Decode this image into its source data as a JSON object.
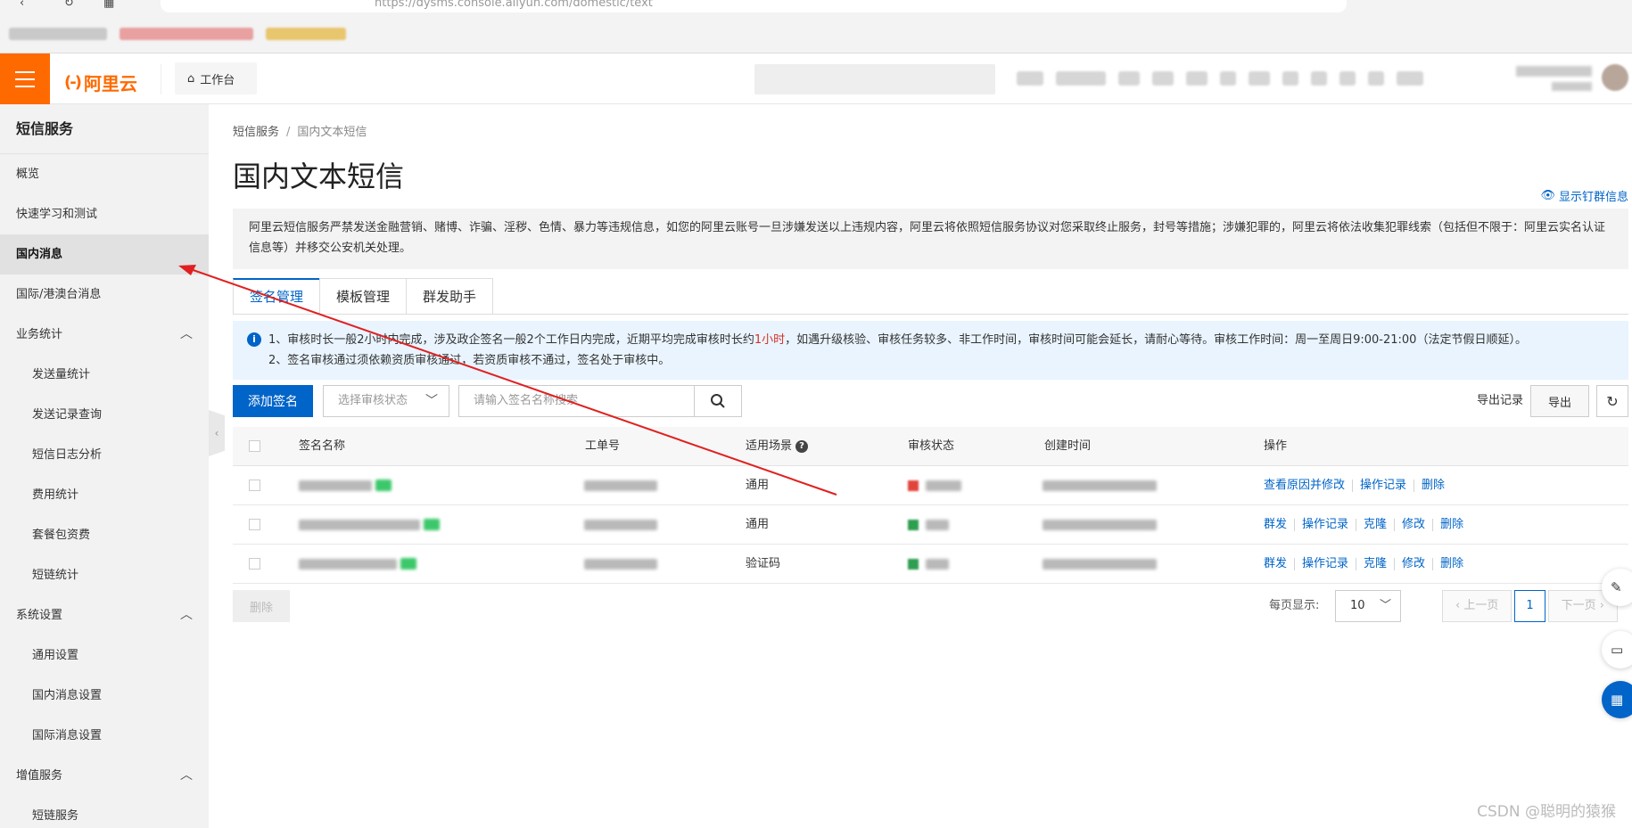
{
  "browser": {
    "url": "https://dysms.console.aliyun.com/domestic/text"
  },
  "header": {
    "logo_text": "阿里云",
    "logo_mark": "(-)",
    "workbench_label": "工作台"
  },
  "sidebar": {
    "title": "短信服务",
    "items": [
      {
        "label": "概览"
      },
      {
        "label": "快速学习和测试"
      },
      {
        "label": "国内消息"
      },
      {
        "label": "国际/港澳台消息"
      },
      {
        "label": "业务统计"
      },
      {
        "label": "发送量统计"
      },
      {
        "label": "发送记录查询"
      },
      {
        "label": "短信日志分析"
      },
      {
        "label": "费用统计"
      },
      {
        "label": "套餐包资费"
      },
      {
        "label": "短链统计"
      },
      {
        "label": "系统设置"
      },
      {
        "label": "通用设置"
      },
      {
        "label": "国内消息设置"
      },
      {
        "label": "国际消息设置"
      },
      {
        "label": "增值服务"
      },
      {
        "label": "短链服务"
      }
    ]
  },
  "breadcrumb": {
    "root": "短信服务",
    "separator": "/",
    "current": "国内文本短信"
  },
  "page": {
    "title": "国内文本短信",
    "show_info_link": "显示钉群信息"
  },
  "notice": {
    "text": "阿里云短信服务严禁发送金融营销、赌博、诈骗、淫秽、色情、暴力等违规信息，如您的阿里云账号一旦涉嫌发送以上违规内容，阿里云将依照短信服务协议对您采取终止服务，封号等措施；涉嫌犯罪的，阿里云将依法收集犯罪线索（包括但不限于：阿里云实名认证信息等）并移交公安机关处理。"
  },
  "tabs": [
    {
      "label": "签名管理",
      "active": true
    },
    {
      "label": "模板管理",
      "active": false
    },
    {
      "label": "群发助手",
      "active": false
    }
  ],
  "info_box": {
    "line1_pre": "1、审核时长一般2小时内完成，涉及政企签名一般2个工作日内完成，近期平均完成审核时长约",
    "line1_highlight": "1小时",
    "line1_post": "，如遇升级核验、审核任务较多、非工作时间，审核时间可能会延长，请耐心等待。审核工作时间：周一至周日9:00-21:00（法定节假日顺延）。",
    "line2": "2、签名审核通过须依赖资质审核通过，若资质审核不通过，签名处于审核中。",
    "highlight_color": "#d93026"
  },
  "toolbar": {
    "add_label": "添加签名",
    "status_placeholder": "选择审核状态",
    "search_placeholder": "请输入签名名称搜索",
    "export_records_label": "导出记录",
    "export_label": "导出"
  },
  "table": {
    "headers": {
      "name": "签名名称",
      "ticket": "工单号",
      "scene": "适用场景",
      "status": "审核状态",
      "created": "创建时间",
      "actions": "操作"
    },
    "rows": [
      {
        "scene": "通用",
        "status_color": "#e0443a",
        "actions": [
          "查看原因并修改",
          "操作记录",
          "删除"
        ]
      },
      {
        "scene": "通用",
        "status_color": "#2e9e4f",
        "actions": [
          "群发",
          "操作记录",
          "克隆",
          "修改",
          "删除"
        ]
      },
      {
        "scene": "验证码",
        "status_color": "#2e9e4f",
        "actions": [
          "群发",
          "操作记录",
          "克隆",
          "修改",
          "删除"
        ]
      }
    ]
  },
  "footer": {
    "delete_label": "删除",
    "page_size_label": "每页显示:",
    "page_size": "10",
    "prev_label": "上一页",
    "current_page": "1",
    "next_label": "下一页"
  },
  "watermark": "CSDN @聪明的猿猴",
  "colors": {
    "brand": "#ff6a00",
    "primary": "#0064c8",
    "annotation_arrow": "#e02020"
  }
}
